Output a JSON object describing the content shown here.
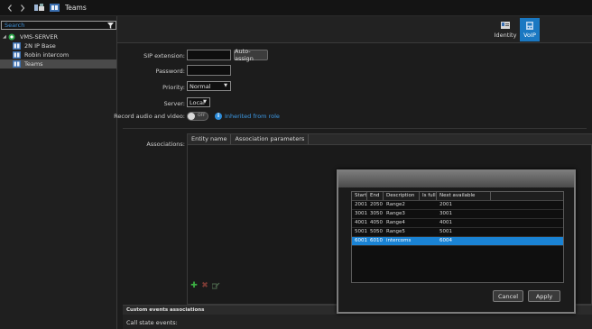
{
  "topbar": {
    "title": "Teams",
    "back_icon": "chevron-left-icon",
    "forward_icon": "chevron-right-icon"
  },
  "sidebar": {
    "search_placeholder": "Search",
    "tree": [
      {
        "label": "VMS-SERVER",
        "icon": "server-icon",
        "level": 0,
        "expanded": true,
        "selected": false
      },
      {
        "label": "2N IP Base",
        "icon": "intercom-icon",
        "level": 1,
        "selected": false
      },
      {
        "label": "Robin intercom",
        "icon": "intercom-icon",
        "level": 1,
        "selected": false
      },
      {
        "label": "Teams",
        "icon": "team-icon",
        "level": 1,
        "selected": true
      }
    ]
  },
  "tabs": [
    {
      "label": "Identity",
      "icon": "identity-icon",
      "active": false
    },
    {
      "label": "VoIP",
      "icon": "voip-icon",
      "active": true
    }
  ],
  "form": {
    "sip_extension_label": "SIP extension:",
    "sip_extension_value": "",
    "auto_assign_label": "Auto-assign",
    "password_label": "Password:",
    "password_value": "",
    "priority_label": "Priority:",
    "priority_value": "Normal",
    "server_label": "Server:",
    "server_value": "Local",
    "record_label": "Record audio and video:",
    "record_toggle": "OFF",
    "inherited_label": "Inherited from role"
  },
  "associations": {
    "label": "Associations:",
    "columns": [
      "Entity name",
      "Association parameters"
    ]
  },
  "custom_events": {
    "header": "Custom events associations",
    "call_state_label": "Call state events:"
  },
  "dialog": {
    "columns": [
      "Start",
      "End",
      "Description",
      "Is full",
      "Next available"
    ],
    "rows": [
      {
        "start": "2001",
        "end": "2050",
        "description": "Range2",
        "is_full": "",
        "next": "2001",
        "selected": false
      },
      {
        "start": "3001",
        "end": "3050",
        "description": "Range3",
        "is_full": "",
        "next": "3001",
        "selected": false
      },
      {
        "start": "4001",
        "end": "4050",
        "description": "Range4",
        "is_full": "",
        "next": "4001",
        "selected": false
      },
      {
        "start": "5001",
        "end": "5050",
        "description": "Range5",
        "is_full": "",
        "next": "5001",
        "selected": false
      },
      {
        "start": "6001",
        "end": "6010",
        "description": "intercoms",
        "is_full": "",
        "next": "6004",
        "selected": true
      }
    ],
    "cancel_label": "Cancel",
    "apply_label": "Apply"
  },
  "colors": {
    "accent": "#1a78c2",
    "selection": "#1a83d4",
    "link": "#3d9ae6",
    "add": "#3cb043",
    "delete": "#c0392b"
  }
}
